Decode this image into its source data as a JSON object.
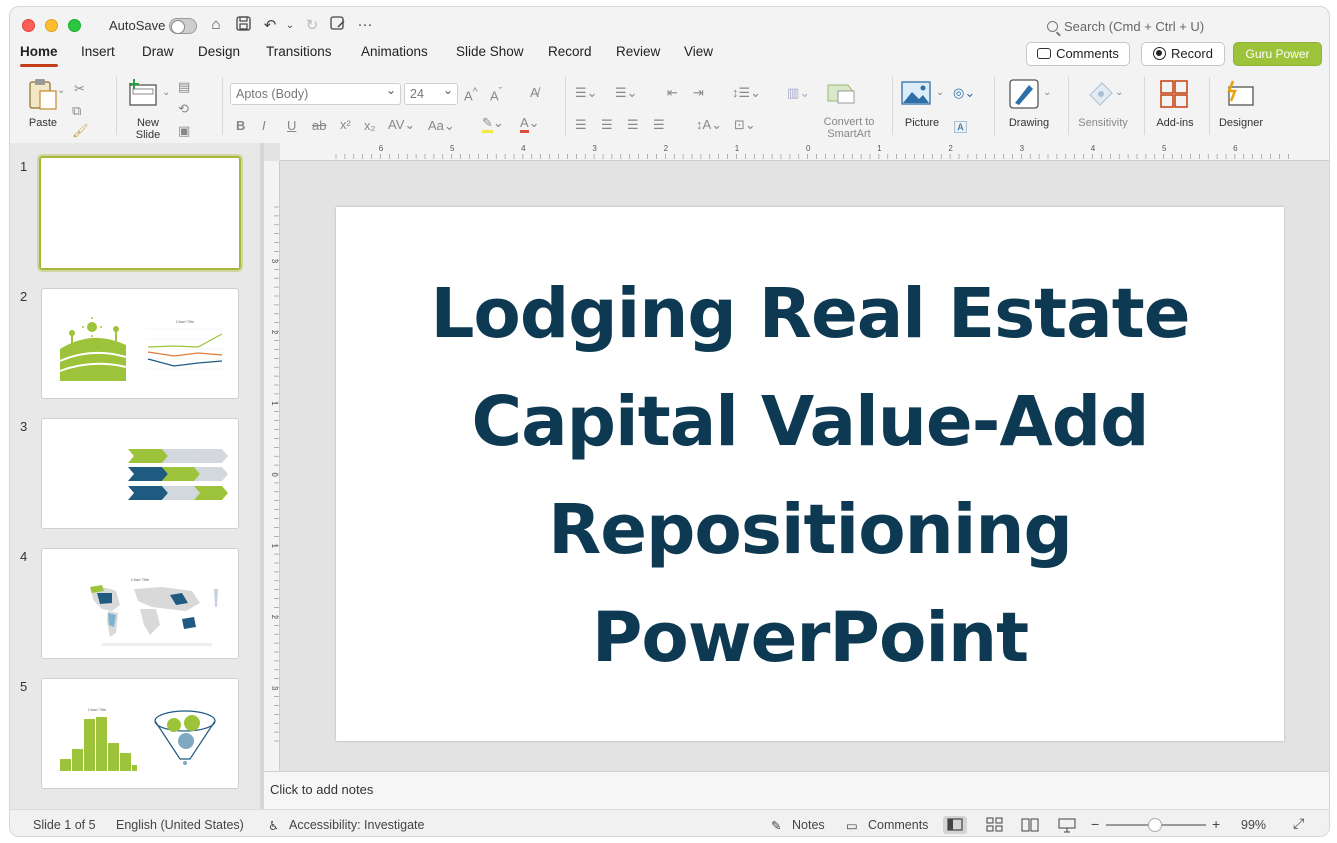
{
  "titlebar": {
    "autosave_label": "AutoSave",
    "search_placeholder": "Search (Cmd + Ctrl + U)"
  },
  "tabs": [
    {
      "label": "Home",
      "active": true
    },
    {
      "label": "Insert"
    },
    {
      "label": "Draw"
    },
    {
      "label": "Design"
    },
    {
      "label": "Transitions"
    },
    {
      "label": "Animations"
    },
    {
      "label": "Slide Show"
    },
    {
      "label": "Record"
    },
    {
      "label": "Review"
    },
    {
      "label": "View"
    }
  ],
  "top_buttons": {
    "comments": "Comments",
    "record": "Record",
    "guru": "Guru Power"
  },
  "ribbon": {
    "paste": "Paste",
    "new_slide": "New Slide",
    "font_name": "Aptos (Body)",
    "font_size": "24",
    "convert_smartart": "Convert to SmartArt",
    "picture": "Picture",
    "drawing": "Drawing",
    "sensitivity": "Sensitivity",
    "addins": "Add-ins",
    "designer": "Designer"
  },
  "ruler": {
    "h_ticks": [
      "6",
      "5",
      "4",
      "3",
      "2",
      "1",
      "0",
      "1",
      "2",
      "3",
      "4",
      "5",
      "6"
    ],
    "v_ticks": [
      "3",
      "2",
      "1",
      "0",
      "1",
      "2",
      "3"
    ]
  },
  "thumbnails": [
    {
      "number": "1",
      "selected": true
    },
    {
      "number": "2",
      "chart_title": "Chart Title"
    },
    {
      "number": "3"
    },
    {
      "number": "4",
      "chart_title": "Chart Title"
    },
    {
      "number": "5",
      "chart_title": "Chart Title"
    }
  ],
  "slide": {
    "title_lines": [
      "Lodging Real Estate",
      "Capital Value-Add",
      "Repositioning",
      "PowerPoint"
    ]
  },
  "notes_placeholder": "Click to add notes",
  "status": {
    "slide_of": "Slide 1 of 5",
    "language": "English (United States)",
    "accessibility": "Accessibility: Investigate",
    "notes": "Notes",
    "comments": "Comments",
    "zoom": "99%"
  },
  "colors": {
    "title_text": "#0d3a52",
    "accent_green": "#9dc33b",
    "tab_underline": "#c43e1c",
    "dark_blue": "#1f5a80"
  }
}
